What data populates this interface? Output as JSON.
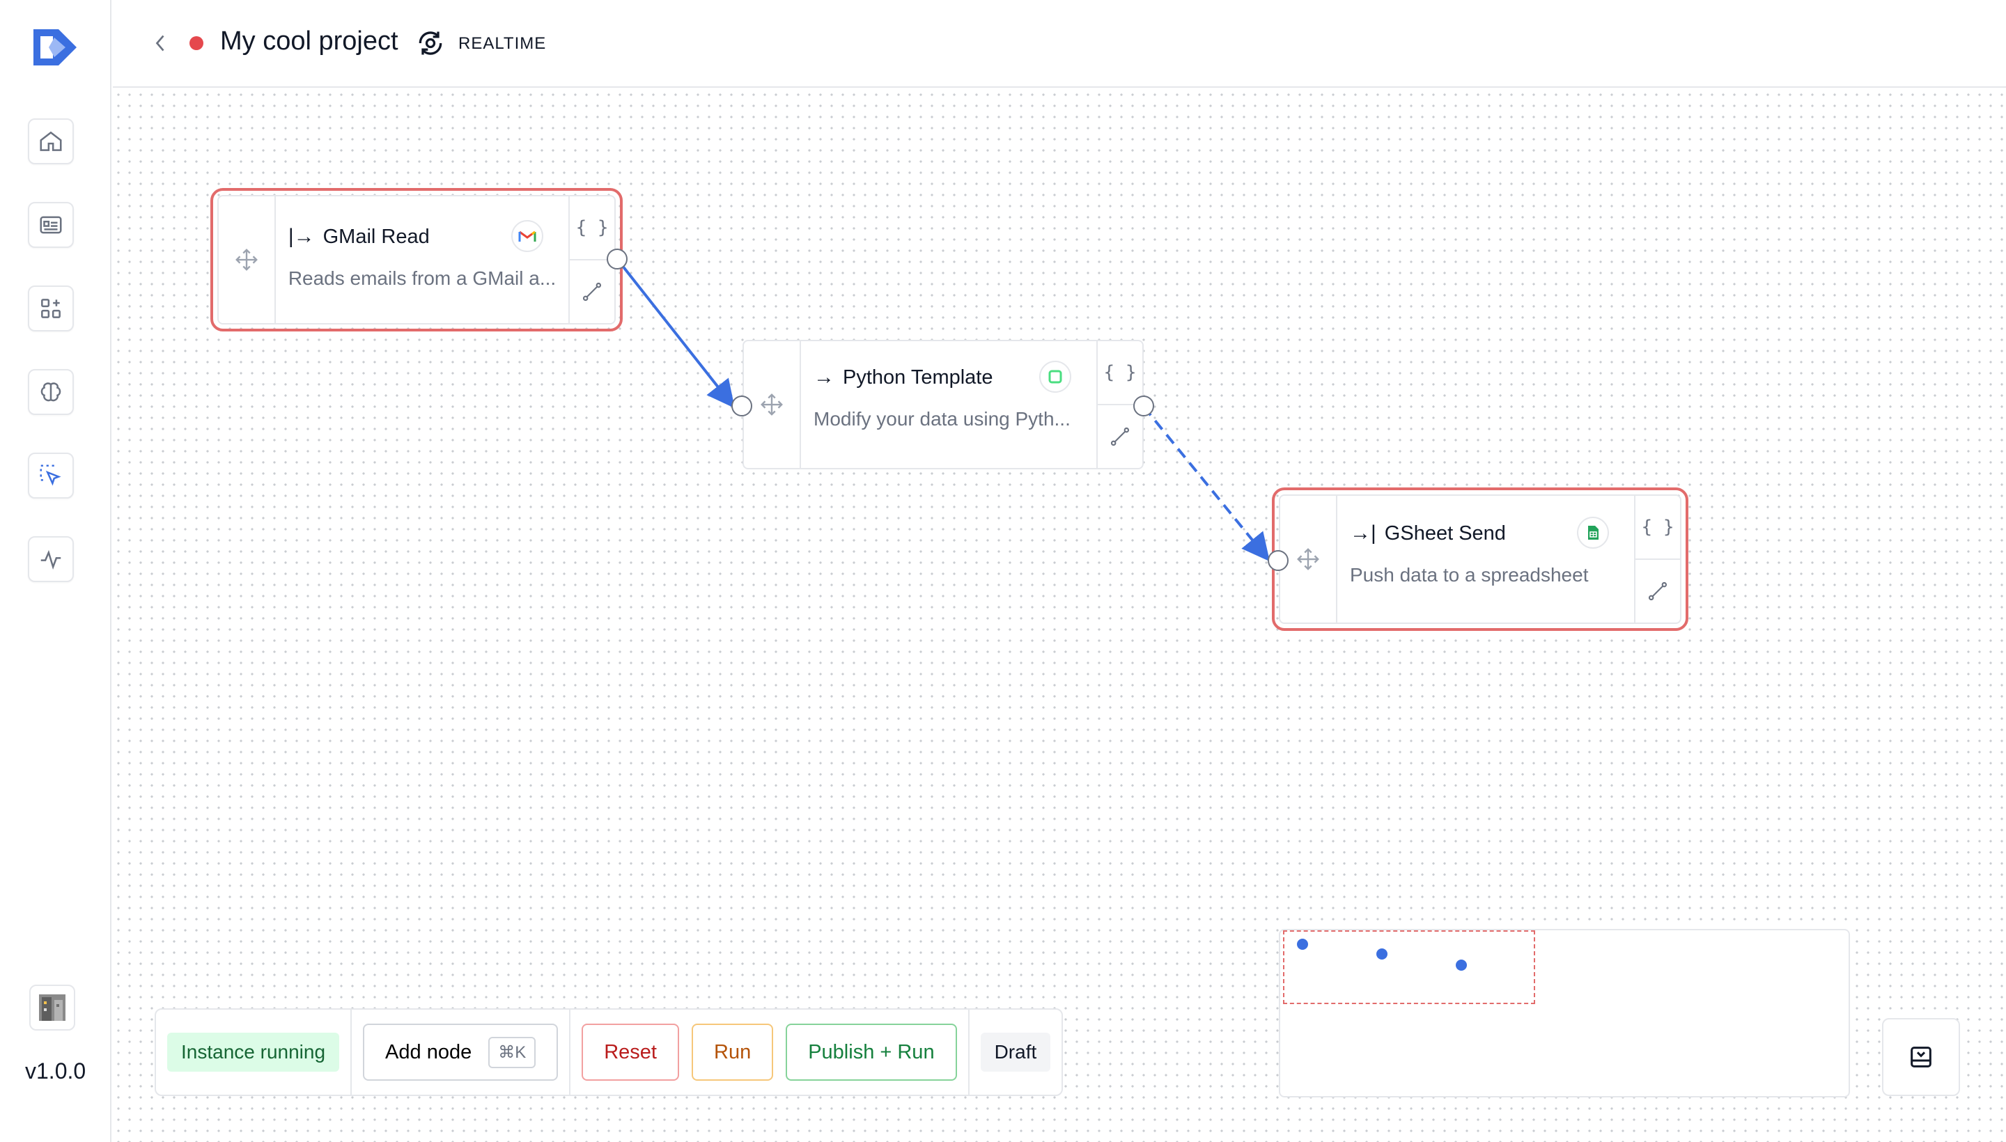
{
  "app": {
    "version": "v1.0.0"
  },
  "header": {
    "project_title": "My cool project",
    "mode_label": "REALTIME",
    "status_color": "#e5484d"
  },
  "sidebar": {
    "items": [
      {
        "icon": "home-icon"
      },
      {
        "icon": "id-card-icon"
      },
      {
        "icon": "apps-add-icon"
      },
      {
        "icon": "brain-icon"
      },
      {
        "icon": "select-pointer-icon",
        "active": true
      },
      {
        "icon": "activity-icon"
      }
    ]
  },
  "nodes": [
    {
      "id": "gmail-read",
      "kind_glyph": "|→",
      "name": "GMail Read",
      "description": "Reads emails from a GMail a...",
      "selected": true,
      "badge_icon": "gmail-icon",
      "json_glyph": "{ }"
    },
    {
      "id": "python-template",
      "kind_glyph": "→",
      "name": "Python Template",
      "description": "Modify your data using Pyth...",
      "selected": false,
      "badge_icon": "python-icon",
      "json_glyph": "{ }"
    },
    {
      "id": "gsheet-send",
      "kind_glyph": "→|",
      "name": "GSheet Send",
      "description": "Push data to a spreadsheet",
      "selected": true,
      "badge_icon": "gsheet-icon",
      "json_glyph": "{ }"
    }
  ],
  "toolbar": {
    "status": "Instance running",
    "add_node": "Add node",
    "add_node_shortcut": "⌘K",
    "reset": "Reset",
    "run": "Run",
    "publish_run": "Publish + Run",
    "draft": "Draft"
  },
  "colors": {
    "accent": "#3b6fe0",
    "selection": "#e26b6b",
    "running_bg": "#dcfce7"
  }
}
